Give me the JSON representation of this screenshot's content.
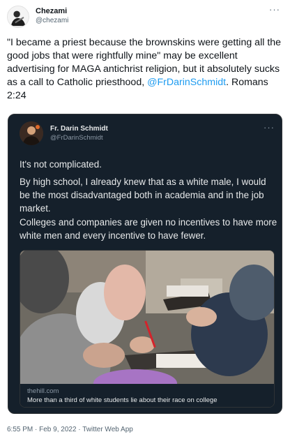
{
  "tweet": {
    "author_name": "Chezami",
    "author_handle": "@chezami",
    "text_part1": "\"I became a priest because the brownskins were getting all the good jobs that were rightfully mine\" may be excellent advertising for MAGA antichrist religion, but it absolutely sucks as a call to Catholic priesthood, ",
    "mention": "@FrDarinSchmidt",
    "text_part2": ". Romans 2:24",
    "more_icon": "ellipsis-icon",
    "meta": "6:55 PM · Feb 9, 2022 · Twitter Web App"
  },
  "quoted": {
    "author_name": "Fr. Darin Schmidt",
    "author_handle": "@FrDarinSchmidt",
    "more_icon": "ellipsis-icon",
    "paragraphs": [
      "It's not complicated.",
      "By high school, I already knew that as a white male, I would be the most disadvantaged both in academia and in the job market.",
      "Colleges and companies are given no incentives to have more white men and every incentive to have fewer."
    ],
    "link": {
      "domain": "thehill.com",
      "title": "More than a third of white students lie about their race on college"
    }
  },
  "colors": {
    "accent": "#1d9bf0",
    "quote_bg": "#15202b",
    "text_dark": "#0f1419",
    "muted": "#536471"
  }
}
